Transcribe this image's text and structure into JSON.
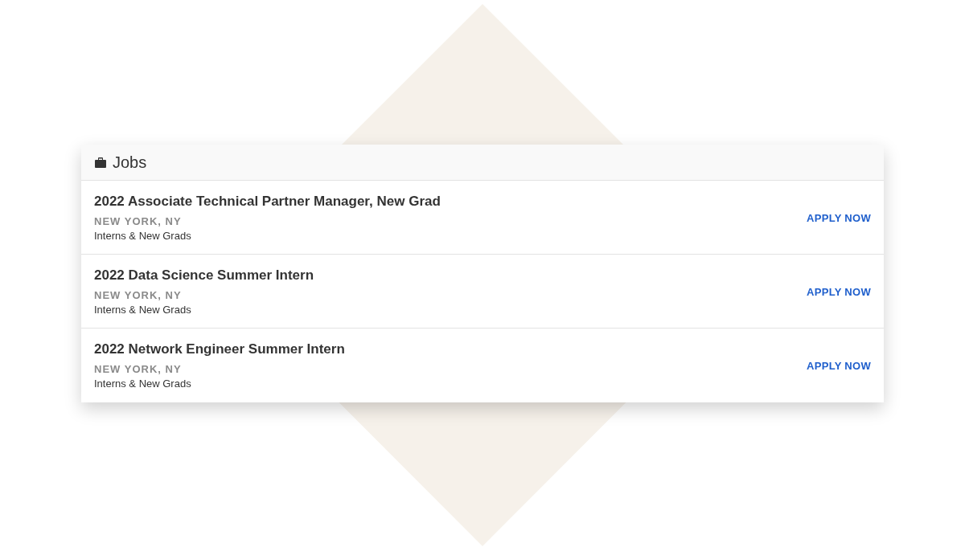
{
  "panel": {
    "title": "Jobs"
  },
  "jobs": [
    {
      "title": "2022 Associate Technical Partner Manager, New Grad",
      "location": "NEW YORK, NY",
      "category": "Interns & New Grads",
      "action": "APPLY NOW"
    },
    {
      "title": "2022 Data Science Summer Intern",
      "location": "NEW YORK, NY",
      "category": "Interns & New Grads",
      "action": "APPLY NOW"
    },
    {
      "title": "2022 Network Engineer Summer Intern",
      "location": "NEW YORK, NY",
      "category": "Interns & New Grads",
      "action": "APPLY NOW"
    }
  ]
}
